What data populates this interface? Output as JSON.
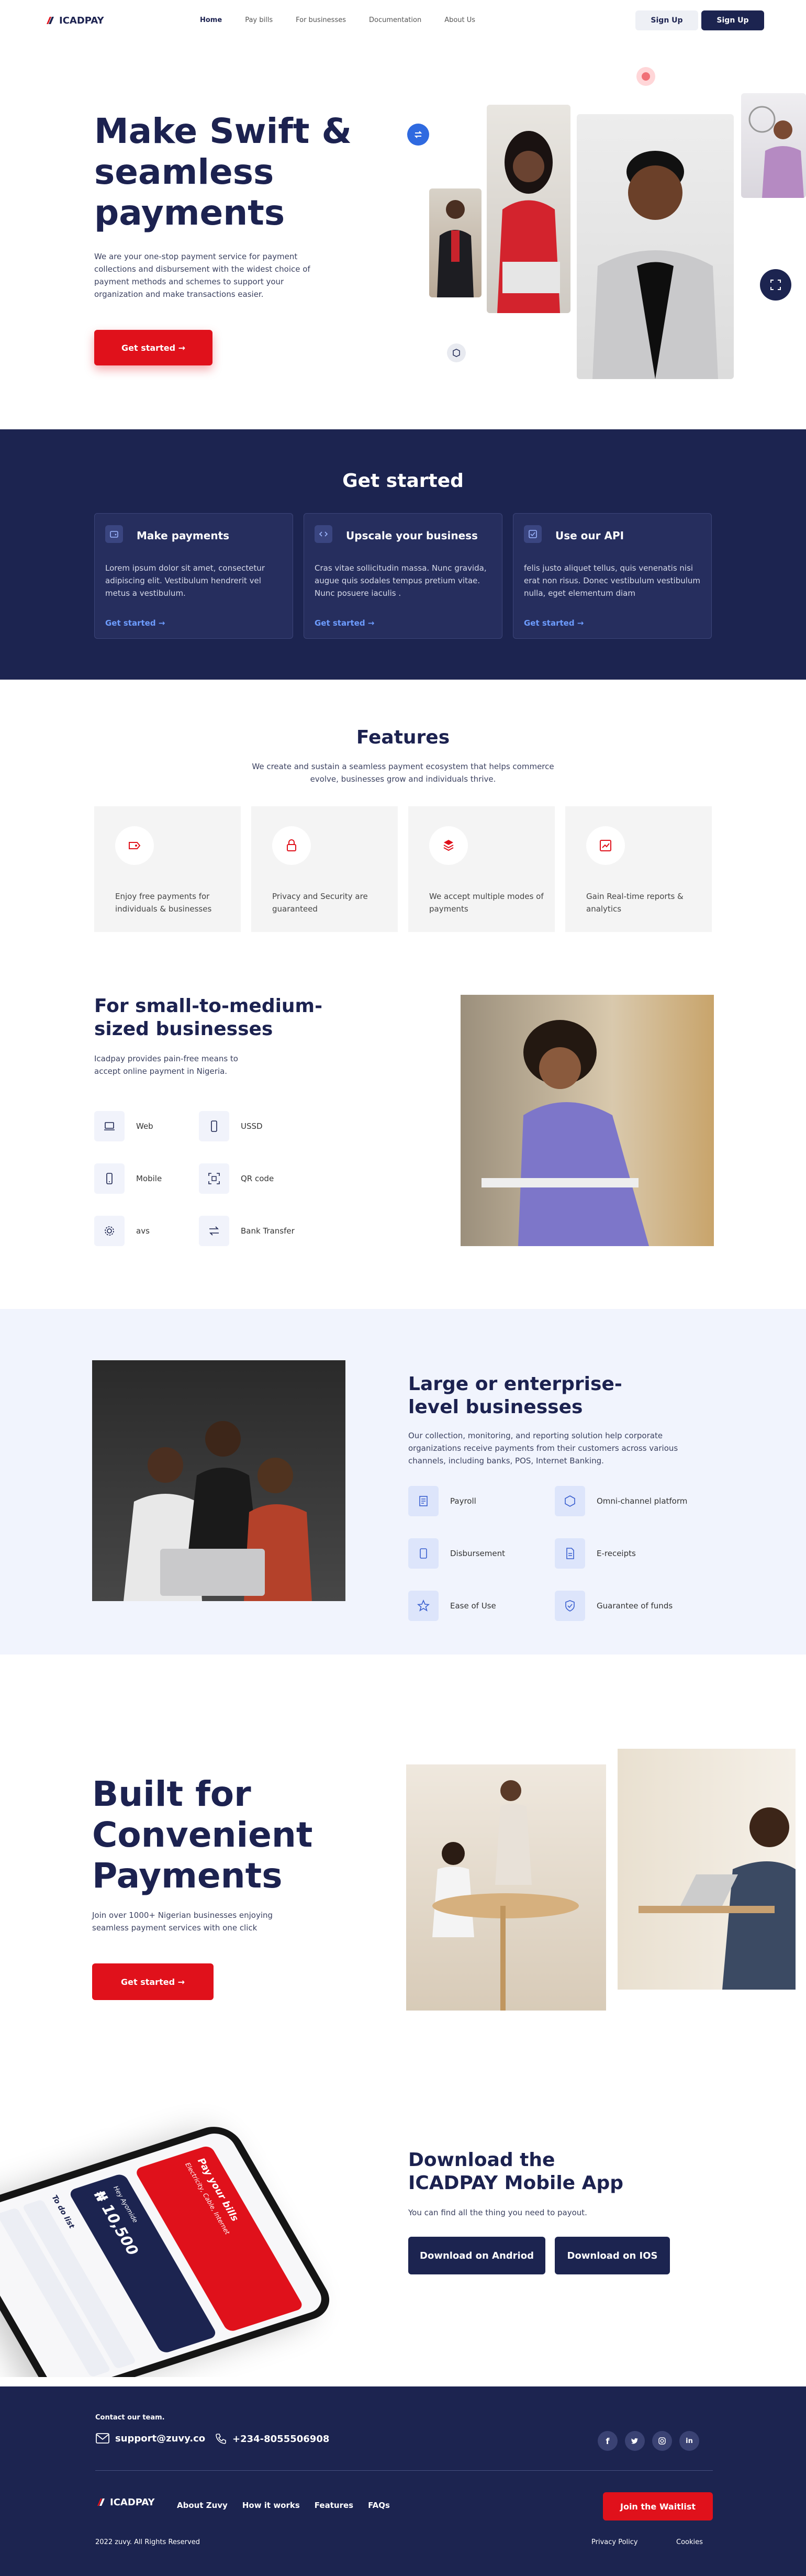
{
  "nav": {
    "brand": "ICADPAY",
    "links": [
      "Home",
      "Pay bills",
      "For businesses",
      "Documentation",
      "About Us"
    ],
    "signin": "Sign Up",
    "signup": "Sign Up"
  },
  "hero": {
    "title": "Make Swift & seamless payments",
    "text": "We are your one-stop payment service for payment collections and disbursement with the widest choice of payment methods and schemes to support your organization and make transactions easier.",
    "cta": "Get started →"
  },
  "get_started": {
    "title": "Get started",
    "cards": [
      {
        "title": "Make payments",
        "text": "Lorem ipsum dolor sit amet, consectetur adipiscing elit. Vestibulum hendrerit vel metus a vestibulum.",
        "link": "Get started →"
      },
      {
        "title": "Upscale your business",
        "text": "Cras vitae sollicitudin massa. Nunc gravida, augue quis sodales tempus pretium vitae. Nunc posuere iaculis .",
        "link": "Get started →"
      },
      {
        "title": "Use our API",
        "text": "felis justo aliquet tellus, quis venenatis nisi erat non risus. Donec vestibulum vestibulum nulla, eget elementum diam",
        "link": "Get started →"
      }
    ]
  },
  "features": {
    "title": "Features",
    "subtitle": "We create and sustain a seamless payment ecosystem that helps commerce evolve, businesses grow and individuals thrive.",
    "items": [
      {
        "icon": "tag-icon",
        "text": "Enjoy free payments  for individuals & businesses"
      },
      {
        "icon": "lock-icon",
        "text": "Privacy and Security are guaranteed"
      },
      {
        "icon": "layers-icon",
        "text": "We accept multiple modes of payments"
      },
      {
        "icon": "chart-icon",
        "text": "Gain Real-time reports & analytics"
      }
    ]
  },
  "smb": {
    "title": "For small-to-medium-sized businesses",
    "text": "Icadpay provides pain-free means to accept online payment in Nigeria.",
    "items": [
      "Web",
      "USSD",
      "Mobile",
      "QR code",
      "avs",
      "Bank Transfer"
    ]
  },
  "enterprise": {
    "title": "Large or enterprise-level businesses",
    "text": "Our collection, monitoring, and reporting solution help corporate organizations receive payments from their customers across various channels, including banks, POS, Internet Banking.",
    "items": [
      "Payroll",
      "Omni-channel platform",
      "Disbursement",
      "E-receipts",
      "Ease of Use",
      "Guarantee of funds"
    ]
  },
  "built": {
    "title": "Built for Convenient Payments",
    "text": "Join over 1000+ Nigerian businesses enjoying seamless payment services with one click",
    "cta": "Get started →"
  },
  "app": {
    "title": "Download the ICADPAY Mobile App",
    "text": "You can find all the thing you need to payout.",
    "android": "Download on Andriod",
    "ios": "Download on IOS",
    "phone": {
      "greeting": "Hey Ayomide",
      "card_title": "Pay your bills",
      "card_sub": "Electricity, Cable, Internet",
      "amount": "₦ 10,500",
      "todo": "To do list"
    }
  },
  "footer": {
    "contact_label": "Contact our team.",
    "email": "support@zuvy.co",
    "phone": "+234-8055506908",
    "brand": "ICADPAY",
    "links": [
      "About Zuvy",
      "How it works",
      "Features",
      "FAQs"
    ],
    "waitlist": "Join the Waitlist",
    "copyright": "2022  zuvy. All Rights Reserved",
    "privacy": "Privacy Policy",
    "cookies": "Cookies"
  },
  "colors": {
    "navy": "#1c2450",
    "red": "#e0111b",
    "blue_link": "#6d9cff"
  }
}
